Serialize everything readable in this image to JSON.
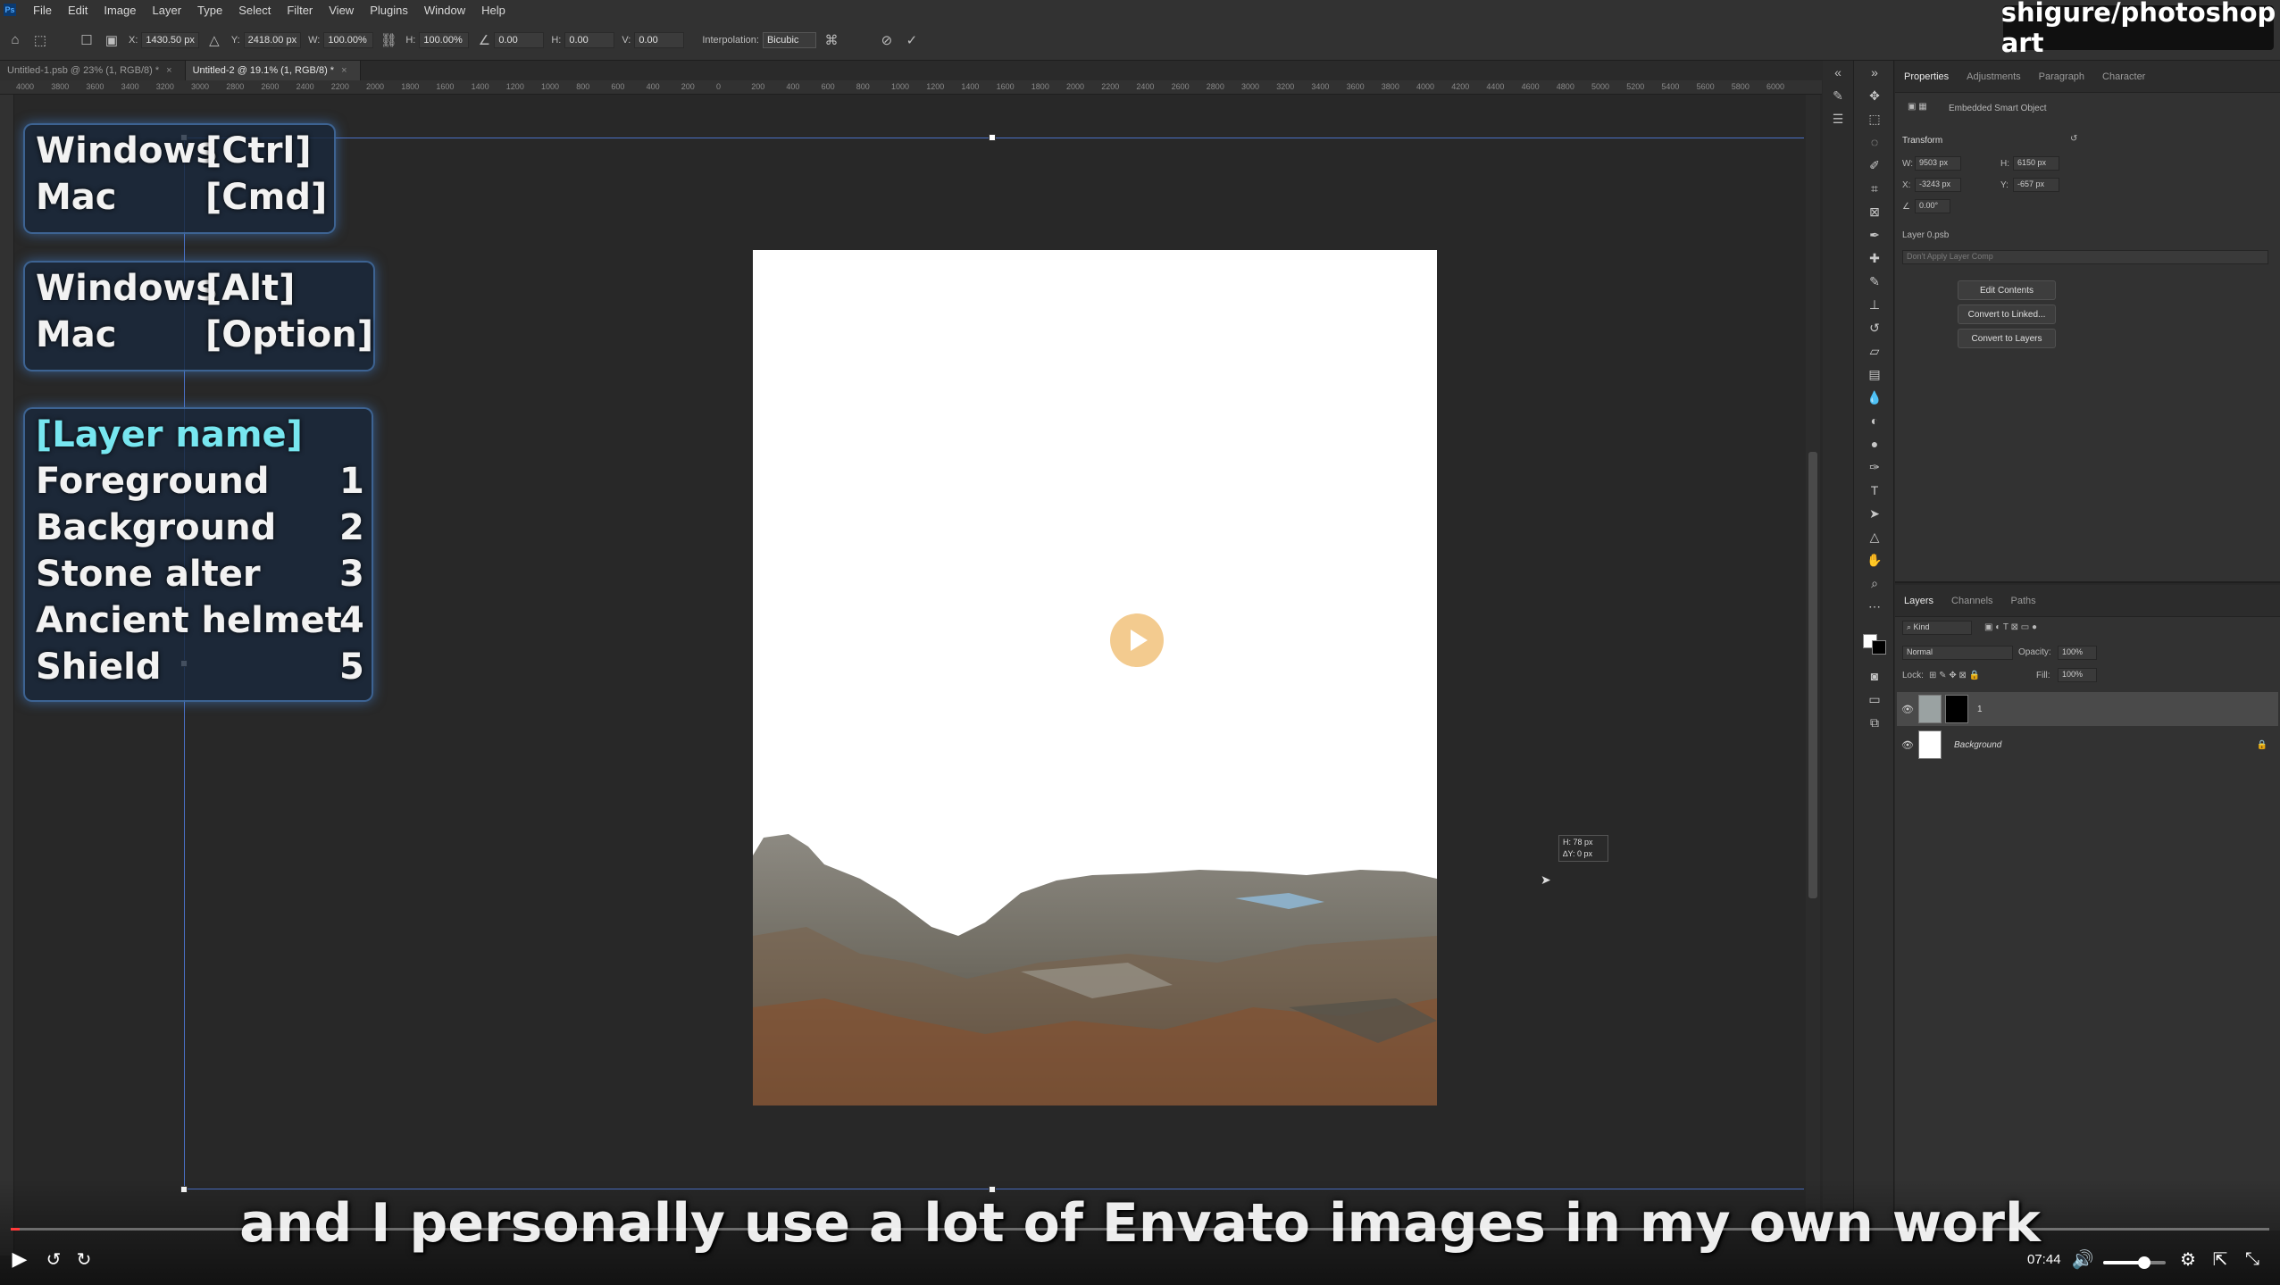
{
  "menubar": {
    "logo": "Ps",
    "items": [
      "File",
      "Edit",
      "Image",
      "Layer",
      "Type",
      "Select",
      "Filter",
      "View",
      "Plugins",
      "Window",
      "Help"
    ]
  },
  "options": {
    "x_label": "X:",
    "x_value": "1430.50 px",
    "y_label": "Y:",
    "y_value": "2418.00 px",
    "w_label": "W:",
    "w_value": "100.00%",
    "h_label": "H:",
    "h_value": "100.00%",
    "angle_value": "0.00",
    "hskew_label": "H:",
    "hskew_value": "0.00",
    "vskew_label": "V:",
    "vskew_value": "0.00",
    "interp_label": "Interpolation:",
    "interp_value": "Bicubic"
  },
  "tabs": [
    {
      "label": "Untitled-1.psb @ 23% (1, RGB/8) *",
      "active": false
    },
    {
      "label": "Untitled-2 @ 19.1% (1, RGB/8) *",
      "active": true
    }
  ],
  "ruler_ticks": [
    "4000",
    "3800",
    "3600",
    "3400",
    "3200",
    "3000",
    "2800",
    "2600",
    "2400",
    "2200",
    "2000",
    "1800",
    "1600",
    "1400",
    "1200",
    "1000",
    "800",
    "600",
    "400",
    "200",
    "0",
    "200",
    "400",
    "600",
    "800",
    "1000",
    "1200",
    "1400",
    "1600",
    "1800",
    "2000",
    "2200",
    "2400",
    "2600",
    "2800",
    "3000",
    "3200",
    "3400",
    "3600",
    "3800",
    "4000",
    "4200",
    "4400",
    "4600",
    "4800",
    "5000",
    "5200",
    "5400",
    "5600",
    "5800",
    "6000"
  ],
  "overlay": {
    "panel1": {
      "row1_os": "Windows",
      "row1_key": "[Ctrl]",
      "row2_os": "Mac",
      "row2_key": "[Cmd]"
    },
    "panel2": {
      "row1_os": "Windows",
      "row1_key": "[Alt]",
      "row2_os": "Mac",
      "row2_key": "[Option]"
    },
    "panel3": {
      "title": "[Layer name]",
      "layers": [
        {
          "name": "Foreground",
          "num": "1"
        },
        {
          "name": "Background",
          "num": "2"
        },
        {
          "name": "Stone alter",
          "num": "3"
        },
        {
          "name": "Ancient helmet",
          "num": "4"
        },
        {
          "name": "Shield",
          "num": "5"
        }
      ]
    }
  },
  "readout": {
    "line1": "H: 78 px",
    "line2": "∆Y: 0 px"
  },
  "watermark": "shigure/photoshop art",
  "properties": {
    "tabs": [
      "Properties",
      "Adjustments",
      "Paragraph",
      "Character"
    ],
    "type_label": "Embedded Smart Object",
    "transform_label": "Transform",
    "w_label": "W:",
    "w_value": "9503 px",
    "h_label": "H:",
    "h_value": "6150 px",
    "x_label": "X:",
    "x_value": "-3243 px",
    "y_label": "Y:",
    "y_value": "-657 px",
    "angle_value": "0.00°",
    "file_label": "Layer 0.psb",
    "comp_placeholder": "Don't Apply Layer Comp",
    "buttons": [
      "Edit Contents",
      "Convert to Linked...",
      "Convert to Layers"
    ]
  },
  "layers_panel": {
    "tabs": [
      "Layers",
      "Channels",
      "Paths"
    ],
    "filter_label": "Kind",
    "blend_mode": "Normal",
    "opacity_label": "Opacity:",
    "opacity_value": "100%",
    "lock_label": "Lock:",
    "fill_label": "Fill:",
    "fill_value": "100%",
    "rows": [
      {
        "name": "1"
      },
      {
        "name": "Background"
      }
    ]
  },
  "video": {
    "caption": "and I personally use a lot of Envato images in my own work",
    "time": "07:44",
    "progress": 0.004,
    "volume": 0.65
  },
  "colors": {
    "accent": "#4a6fc4",
    "overlay_title": "#77e6f0",
    "play_overlay": "#f3c98a"
  }
}
